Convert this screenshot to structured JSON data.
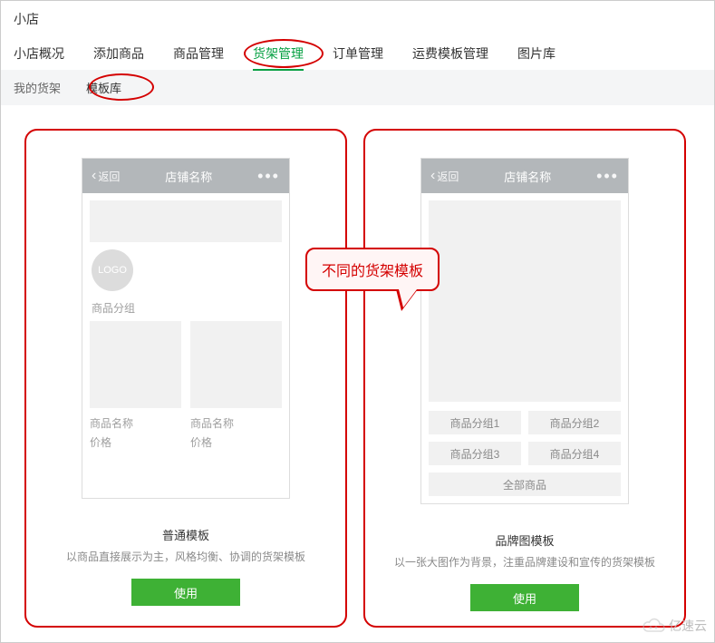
{
  "page": {
    "title": "小店"
  },
  "mainTabs": {
    "items": [
      "小店概况",
      "添加商品",
      "商品管理",
      "货架管理",
      "订单管理",
      "运费模板管理",
      "图片库"
    ],
    "activeIndex": 3
  },
  "subTabs": {
    "items": [
      "我的货架",
      "模板库"
    ],
    "activeIndex": 1
  },
  "callout": {
    "text": "不同的货架模板"
  },
  "phoneHeader": {
    "back": "返回",
    "shopName": "店铺名称"
  },
  "templates": {
    "basic": {
      "logoText": "LOGO",
      "groupLabel": "商品分组",
      "productName": "商品名称",
      "productPrice": "价格",
      "title": "普通模板",
      "desc": "以商品直接展示为主，风格均衡、协调的货架模板",
      "useBtn": "使用"
    },
    "brand": {
      "tags": [
        "商品分组1",
        "商品分组2",
        "商品分组3",
        "商品分组4"
      ],
      "allLabel": "全部商品",
      "title": "品牌图模板",
      "desc": "以一张大图作为背景，注重品牌建设和宣传的货架模板",
      "useBtn": "使用"
    }
  },
  "watermark": {
    "text": "亿速云"
  }
}
